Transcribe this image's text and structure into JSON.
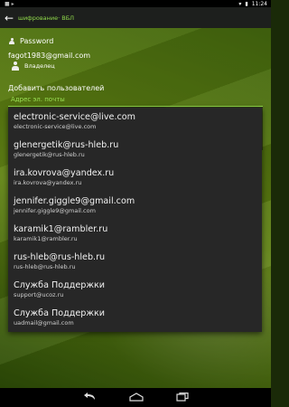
{
  "status": {
    "left_text": "■ ▸",
    "time": "11:24"
  },
  "header": {
    "title": "шифрование· ВБЛ",
    "back_icon": "arrow-left-icon"
  },
  "account": {
    "password_label": "Password",
    "email": "fagot1983@gmail.com",
    "role": "Владелец"
  },
  "add_user": {
    "title": "Добавить пользователей",
    "input_placeholder": "Адрес эл. почты"
  },
  "dropdown": {
    "items": [
      {
        "name": "electronic-service@live.com",
        "email": "electronic-service@live.com"
      },
      {
        "name": "glenergetik@rus-hleb.ru",
        "email": "glenergetik@rus-hleb.ru"
      },
      {
        "name": "ira.kovrova@yandex.ru",
        "email": "ira.kovrova@yandex.ru"
      },
      {
        "name": "jennifer.giggle9@gmail.com",
        "email": "jennifer.giggle9@gmail.com"
      },
      {
        "name": "karamik1@rambler.ru",
        "email": "karamik1@rambler.ru"
      },
      {
        "name": "rus-hleb@rus-hleb.ru",
        "email": "rus-hleb@rus-hleb.ru"
      },
      {
        "name": "Служба Поддержки",
        "email": "support@ucoz.ru"
      },
      {
        "name": "Служба Поддержки",
        "email": "uadmail@gmail.com"
      }
    ]
  },
  "nav": {
    "back_icon": "back-nav-icon",
    "home_icon": "home-nav-icon",
    "recents_icon": "recents-nav-icon"
  }
}
